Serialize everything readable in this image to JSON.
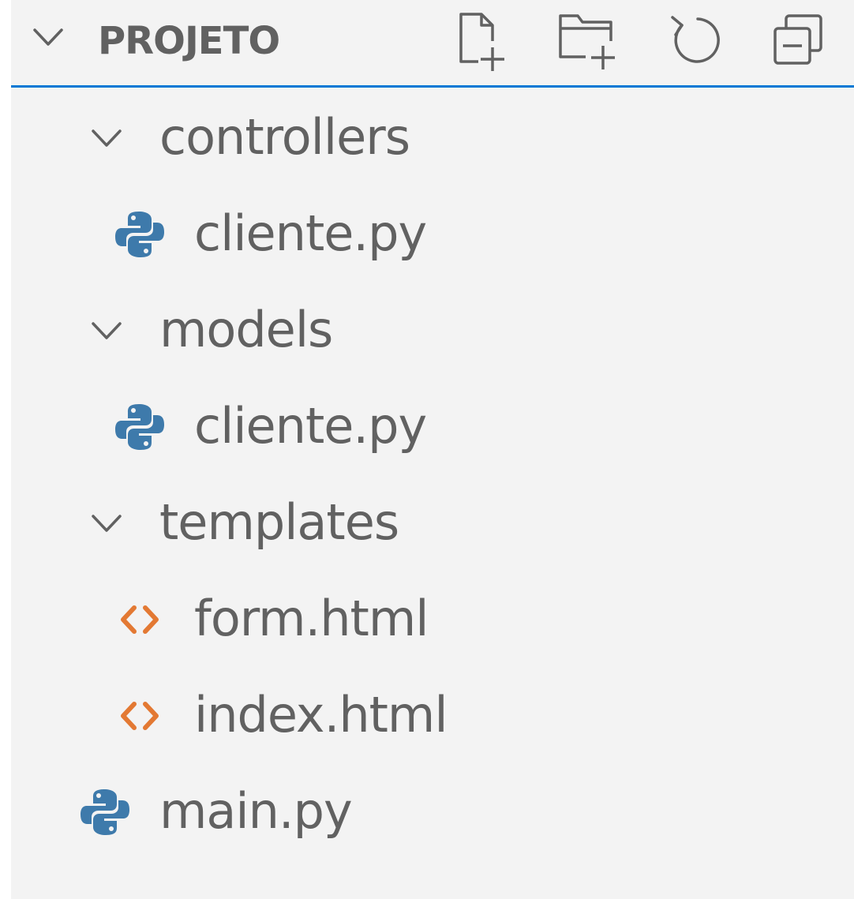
{
  "explorer": {
    "title": "PROJETO",
    "focus_color": "#0078d4",
    "actions": [
      {
        "name": "new-file",
        "icon": "new-file-icon"
      },
      {
        "name": "new-folder",
        "icon": "new-folder-icon"
      },
      {
        "name": "refresh",
        "icon": "refresh-icon"
      },
      {
        "name": "collapse-all",
        "icon": "collapse-all-icon"
      }
    ],
    "tree": [
      {
        "label": "controllers",
        "type": "folder",
        "expanded": true,
        "depth": 1
      },
      {
        "label": "cliente.py",
        "type": "python",
        "depth": 2
      },
      {
        "label": "models",
        "type": "folder",
        "expanded": true,
        "depth": 1
      },
      {
        "label": "cliente.py",
        "type": "python",
        "depth": 2
      },
      {
        "label": "templates",
        "type": "folder",
        "expanded": true,
        "depth": 1
      },
      {
        "label": "form.html",
        "type": "html",
        "depth": 2
      },
      {
        "label": "index.html",
        "type": "html",
        "depth": 2
      },
      {
        "label": "main.py",
        "type": "python",
        "depth": 1
      }
    ],
    "icon_colors": {
      "python": "#3e7aab",
      "html": "#e37933",
      "foreground": "#616161"
    }
  }
}
